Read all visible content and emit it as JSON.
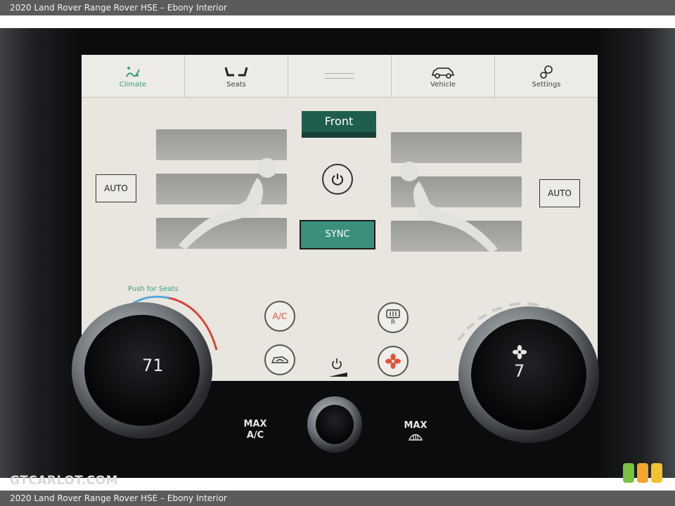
{
  "caption": "2020 Land Rover Range Rover HSE – Ebony Interior",
  "tabs": [
    {
      "label": "Climate",
      "icon": "climate-icon",
      "active": true
    },
    {
      "label": "Seats",
      "icon": "seats-icon",
      "active": false
    },
    {
      "label": "",
      "icon": "drawer-handle-icon",
      "active": false
    },
    {
      "label": "Vehicle",
      "icon": "vehicle-icon",
      "active": false
    },
    {
      "label": "Settings",
      "icon": "settings-icon",
      "active": false
    }
  ],
  "climate": {
    "zone_label": "Front",
    "sync_label": "SYNC",
    "auto_left": "AUTO",
    "auto_right": "AUTO",
    "push_hint": "Push for Seats",
    "ac_label": "A/C",
    "rear_label": "R"
  },
  "dials": {
    "left_temp": "71",
    "right_fan": "7"
  },
  "physical": {
    "max_ac": [
      "MAX",
      "A/C"
    ],
    "max_defrost": "MAX"
  },
  "watermark": "GTCARLOT.COM",
  "colors": {
    "accent": "#3a9c84",
    "front_tab": "#1f5e4f",
    "sync": "#3b8f7d",
    "ac_red": "#e0533a"
  }
}
